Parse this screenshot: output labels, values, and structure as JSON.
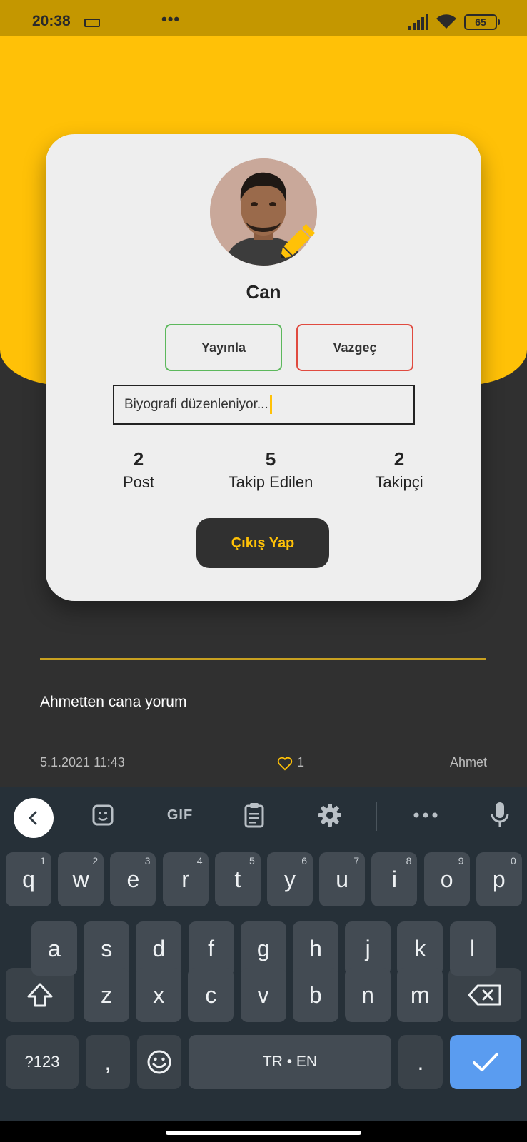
{
  "status_bar": {
    "time": "20:38",
    "dots": "•••",
    "battery": "65"
  },
  "profile": {
    "name": "Can",
    "publish_label": "Yayınla",
    "cancel_label": "Vazgeç",
    "bio_value": "Biyografi düzenleniyor...",
    "stats": [
      {
        "value": "2",
        "label": "Post"
      },
      {
        "value": "5",
        "label": "Takip Edilen"
      },
      {
        "value": "2",
        "label": "Takipçi"
      }
    ],
    "logout_label": "Çıkış Yap"
  },
  "post": {
    "text": "Ahmetten cana yorum",
    "date": "5.1.2021  11:43",
    "likes": "1",
    "author": "Ahmet"
  },
  "keyboard": {
    "toolbar": {
      "gif": "GIF"
    },
    "row1": [
      {
        "key": "q",
        "hint": "1"
      },
      {
        "key": "w",
        "hint": "2"
      },
      {
        "key": "e",
        "hint": "3"
      },
      {
        "key": "r",
        "hint": "4"
      },
      {
        "key": "t",
        "hint": "5"
      },
      {
        "key": "y",
        "hint": "6"
      },
      {
        "key": "u",
        "hint": "7"
      },
      {
        "key": "i",
        "hint": "8"
      },
      {
        "key": "o",
        "hint": "9"
      },
      {
        "key": "p",
        "hint": "0"
      }
    ],
    "row2": [
      "a",
      "s",
      "d",
      "f",
      "g",
      "h",
      "j",
      "k",
      "l"
    ],
    "row3": [
      "z",
      "x",
      "c",
      "v",
      "b",
      "n",
      "m"
    ],
    "bottom": {
      "symbols": "?123",
      "comma": ",",
      "space": "TR • EN",
      "period": "."
    }
  },
  "colors": {
    "accent": "#ffc107",
    "status_bar": "#c49700",
    "background": "#303030",
    "publish_border": "#5cb85c",
    "cancel_border": "#e04a3f",
    "keyboard": "#263038",
    "key": "#434b53",
    "enter": "#5a9cf0"
  }
}
